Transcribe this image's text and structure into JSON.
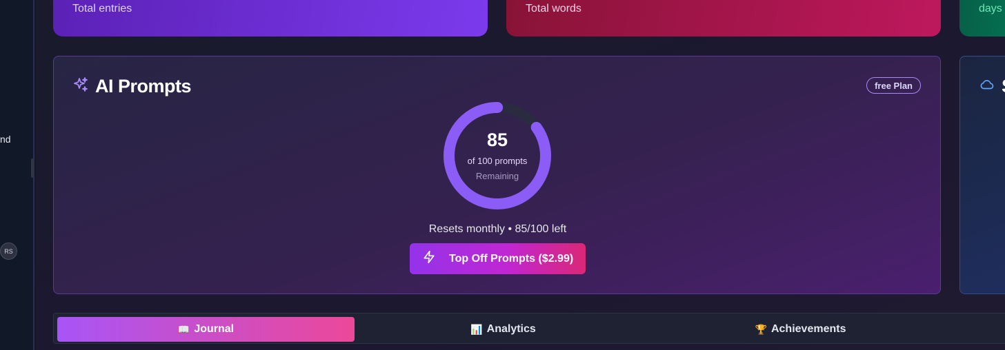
{
  "sidebar": {
    "partial_text": "nd",
    "avatar_initials": "RS"
  },
  "stats": {
    "entries_label": "Total entries",
    "words_label": "Total words",
    "streak_label": "days"
  },
  "ai_prompts": {
    "title": "AI Prompts",
    "plan_badge": "free Plan",
    "remaining_value": "85",
    "total_label": "of 100 prompts",
    "remaining_label": "Remaining",
    "remaining_fraction": 0.85,
    "reset_text": "Resets monthly • 85/100 left",
    "topoff_button": "Top Off Prompts ($2.99)",
    "ring_color": "#8b5cf6",
    "track_color": "#2a2b40"
  },
  "right_card": {
    "title_partial": "S",
    "icon": "cloud-icon"
  },
  "tabs": [
    {
      "emoji": "📖",
      "label": "Journal",
      "active": true
    },
    {
      "emoji": "📊",
      "label": "Analytics",
      "active": false
    },
    {
      "emoji": "🏆",
      "label": "Achievements",
      "active": false
    }
  ],
  "colors": {
    "accent_purple": "#a855f7",
    "accent_pink": "#ec4899"
  }
}
